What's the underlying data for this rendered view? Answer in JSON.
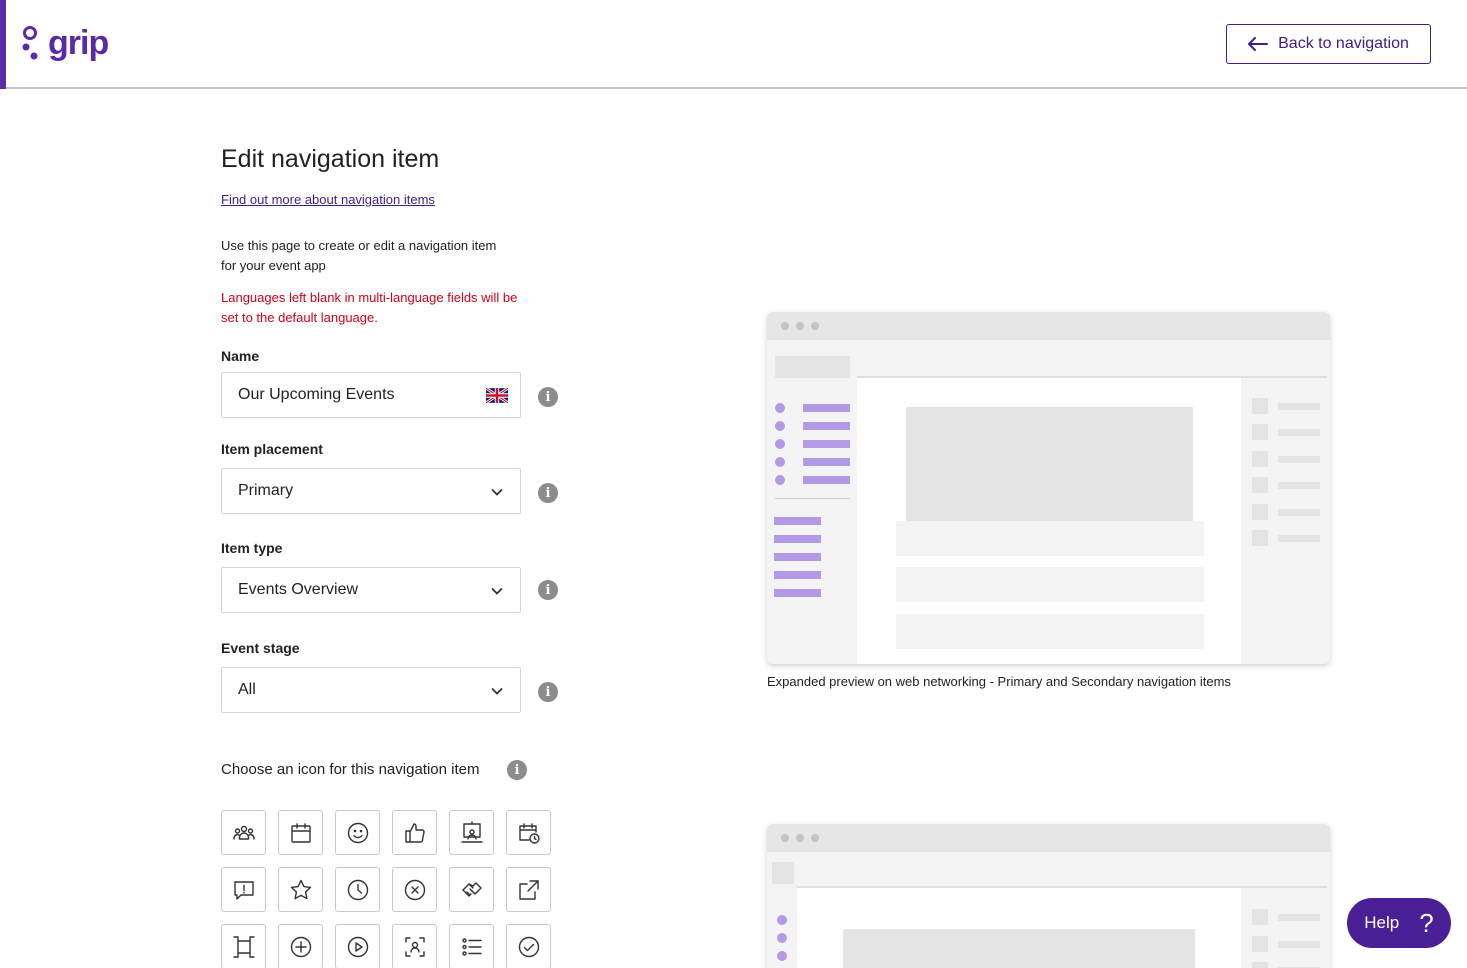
{
  "header": {
    "logo_text": "grip",
    "back_label": "Back to navigation"
  },
  "page": {
    "title": "Edit navigation item",
    "learn_link": "Find out more about navigation items",
    "intro": "Use this page to create or edit a navigation item for your event app",
    "warning": "Languages left blank in multi-language fields will be set to the default language."
  },
  "fields": {
    "name": {
      "label": "Name",
      "value": "Our Upcoming Events"
    },
    "placement": {
      "label": "Item placement",
      "value": "Primary"
    },
    "type": {
      "label": "Item type",
      "value": "Events Overview"
    },
    "stage": {
      "label": "Event stage",
      "value": "All"
    }
  },
  "icons": {
    "heading": "Choose an icon for this navigation item",
    "items": [
      "people-icon",
      "calendar-icon",
      "smiley-icon",
      "thumbs-up-icon",
      "presenter-icon",
      "calendar-clock-icon",
      "speech-alert-icon",
      "star-icon",
      "clock-icon",
      "cancel-circle-icon",
      "handshake-icon",
      "external-link-icon",
      "frame-icon",
      "plus-circle-icon",
      "play-circle-icon",
      "face-scan-icon",
      "list-icon",
      "check-circle-icon"
    ]
  },
  "preview": {
    "caption": "Expanded preview on web networking - Primary and Secondary navigation items"
  },
  "help": {
    "label": "Help",
    "glyph": "?"
  },
  "colors": {
    "brand": "#5b2aa6",
    "warning": "#d0021b",
    "preview_accent": "#b39ae6"
  }
}
